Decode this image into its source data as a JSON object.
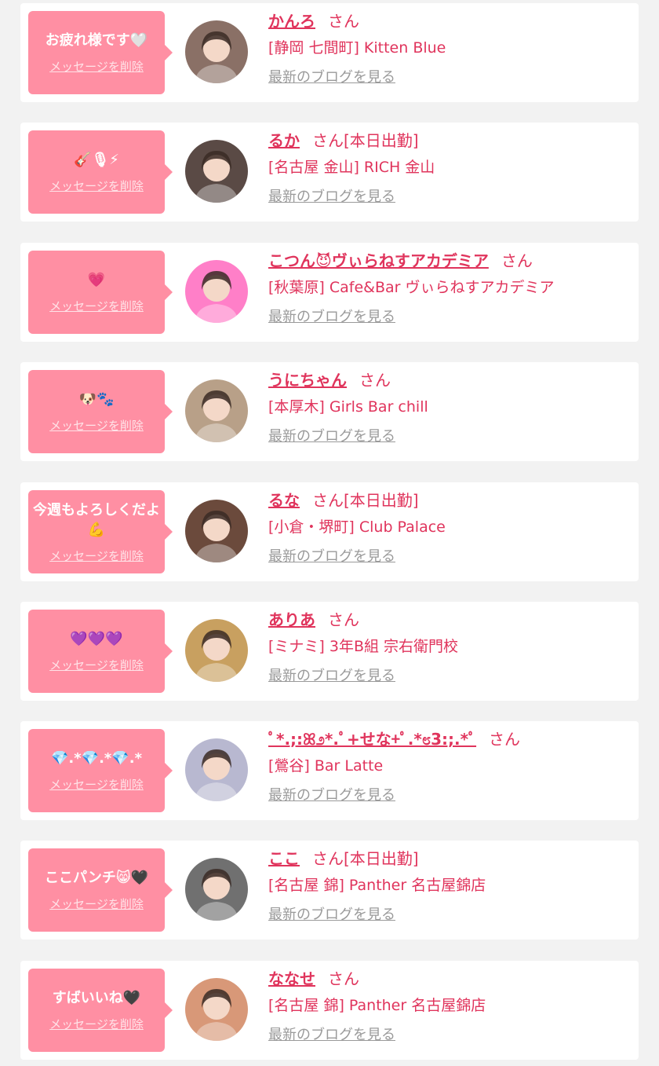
{
  "common": {
    "delete_label": "メッセージを削除",
    "san_label": "さん",
    "blog_label": "最新のブログを見る"
  },
  "colors": {
    "bubble": "#ff8fa3",
    "accent": "#e0345c",
    "link_gray": "#9a9a9a",
    "background": "#f2f2f2"
  },
  "messages": [
    {
      "message": "お疲れ様です🤍",
      "name": "かんろ",
      "status": "",
      "shop": "[静岡 七間町] Kitten Blue",
      "avatar_color": "#8a7066"
    },
    {
      "message": "🎸🎙⚡",
      "name": "るか",
      "status": "[本日出勤]",
      "shop": "[名古屋 金山] RICH 金山",
      "avatar_color": "#5a4a45"
    },
    {
      "message": "💗",
      "name": "こつん😈ヴぃらねすアカデミア",
      "status": "",
      "shop": "[秋葉原] Cafe&Bar ヴぃらねすアカデミア",
      "avatar_color": "#ff7fc8"
    },
    {
      "message": "🐶🐾",
      "name": "うにちゃん",
      "status": "",
      "shop": "[本厚木] Girls Bar chill",
      "avatar_color": "#b8a088"
    },
    {
      "message": "今週もよろしくだよ💪",
      "name": "るな",
      "status": "[本日出勤]",
      "shop": "[小倉・堺町] Club Palace",
      "avatar_color": "#6b4a3c"
    },
    {
      "message": "💜💜💜",
      "name": "ありあ",
      "status": "",
      "shop": "[ミナミ] 3年B組 宗右衛門校",
      "avatar_color": "#c8a060"
    },
    {
      "message": "💎.*💎.*💎.*",
      "name": "ﾟ*.;:ꕤ೨*.ﾟ+せな+ﾟ.*೮3:;.*ﾟ",
      "status": "",
      "shop": "[鶯谷] Bar Latte",
      "avatar_color": "#b8b8d0"
    },
    {
      "message": "ここパンチ😸🖤",
      "name": "ここ",
      "status": "[本日出勤]",
      "shop": "[名古屋 錦] Panther 名古屋錦店",
      "avatar_color": "#707070"
    },
    {
      "message": "すばいいね🖤",
      "name": "ななせ",
      "status": "",
      "shop": "[名古屋 錦] Panther 名古屋錦店",
      "avatar_color": "#d89878"
    }
  ]
}
